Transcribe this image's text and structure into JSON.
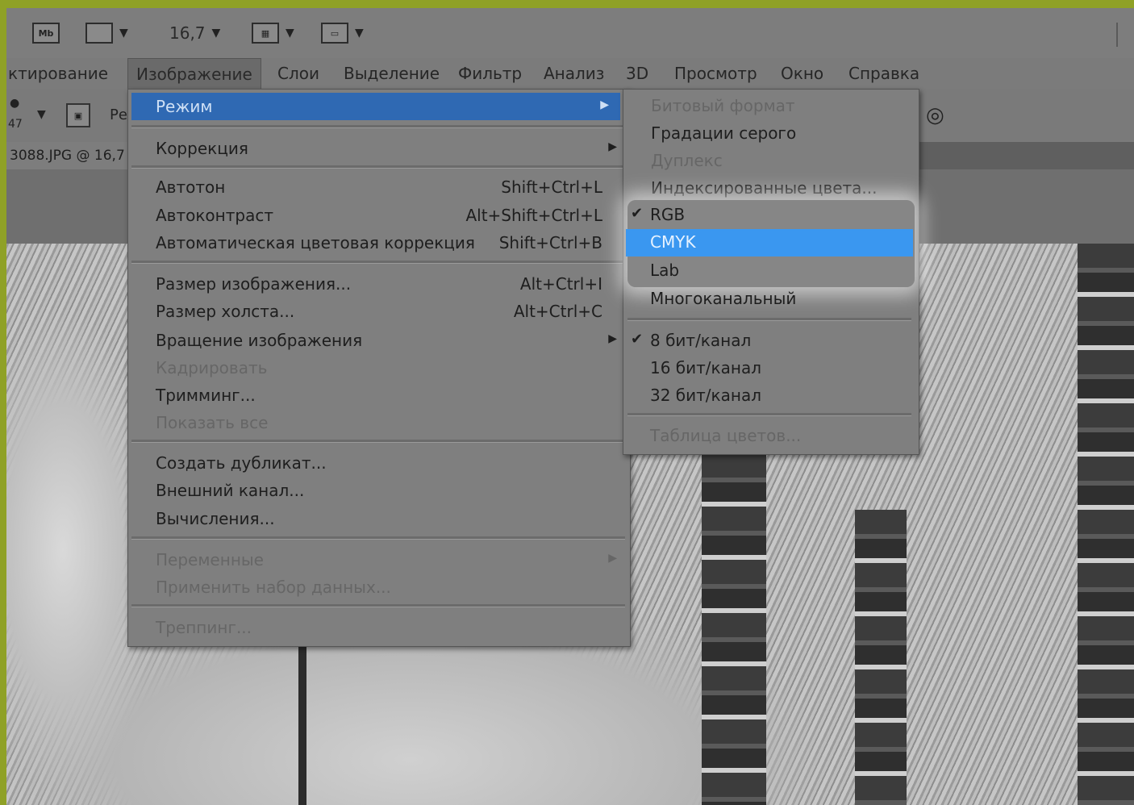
{
  "appbar": {
    "mb_icon": "Mb",
    "zoom": "16,7"
  },
  "menubar": {
    "items": [
      "ктирование",
      "Изображение",
      "Слои",
      "Выделение",
      "Фильтр",
      "Анализ",
      "3D",
      "Просмотр",
      "Окно",
      "Справка"
    ]
  },
  "optbar": {
    "value": "47",
    "partial_label": "Ре"
  },
  "document": {
    "tab": "3088.JPG @ 16,7"
  },
  "image_menu": {
    "mode": "Режим",
    "adjustments": "Коррекция",
    "autotone": {
      "label": "Автотон",
      "shortcut": "Shift+Ctrl+L"
    },
    "autocontrast": {
      "label": "Автоконтраст",
      "shortcut": "Alt+Shift+Ctrl+L"
    },
    "autocolor": {
      "label": "Автоматическая цветовая коррекция",
      "shortcut": "Shift+Ctrl+B"
    },
    "image_size": {
      "label": "Размер изображения...",
      "shortcut": "Alt+Ctrl+I"
    },
    "canvas_size": {
      "label": "Размер холста...",
      "shortcut": "Alt+Ctrl+C"
    },
    "rotation": "Вращение изображения",
    "crop": "Кадрировать",
    "trim": "Тримминг...",
    "reveal_all": "Показать все",
    "duplicate": "Создать дубликат...",
    "apply_image": "Внешний канал...",
    "calculations": "Вычисления...",
    "variables": "Переменные",
    "apply_data_set": "Применить набор данных...",
    "trap": "Треппинг..."
  },
  "mode_submenu": {
    "bitmap": "Битовый формат",
    "grayscale": "Градации серого",
    "duotone": "Дуплекс",
    "indexed": "Индексированные цвета...",
    "rgb": "RGB",
    "cmyk": "CMYK",
    "lab": "Lab",
    "multichannel": "Многоканальный",
    "bits8": "8 бит/канал",
    "bits16": "16 бит/канал",
    "bits32": "32 бит/канал",
    "color_table": "Таблица цветов...",
    "check": "✔"
  },
  "colors": {
    "highlight": "#2f69b3",
    "selected": "#3a97f0",
    "frame": "#8fa126"
  }
}
